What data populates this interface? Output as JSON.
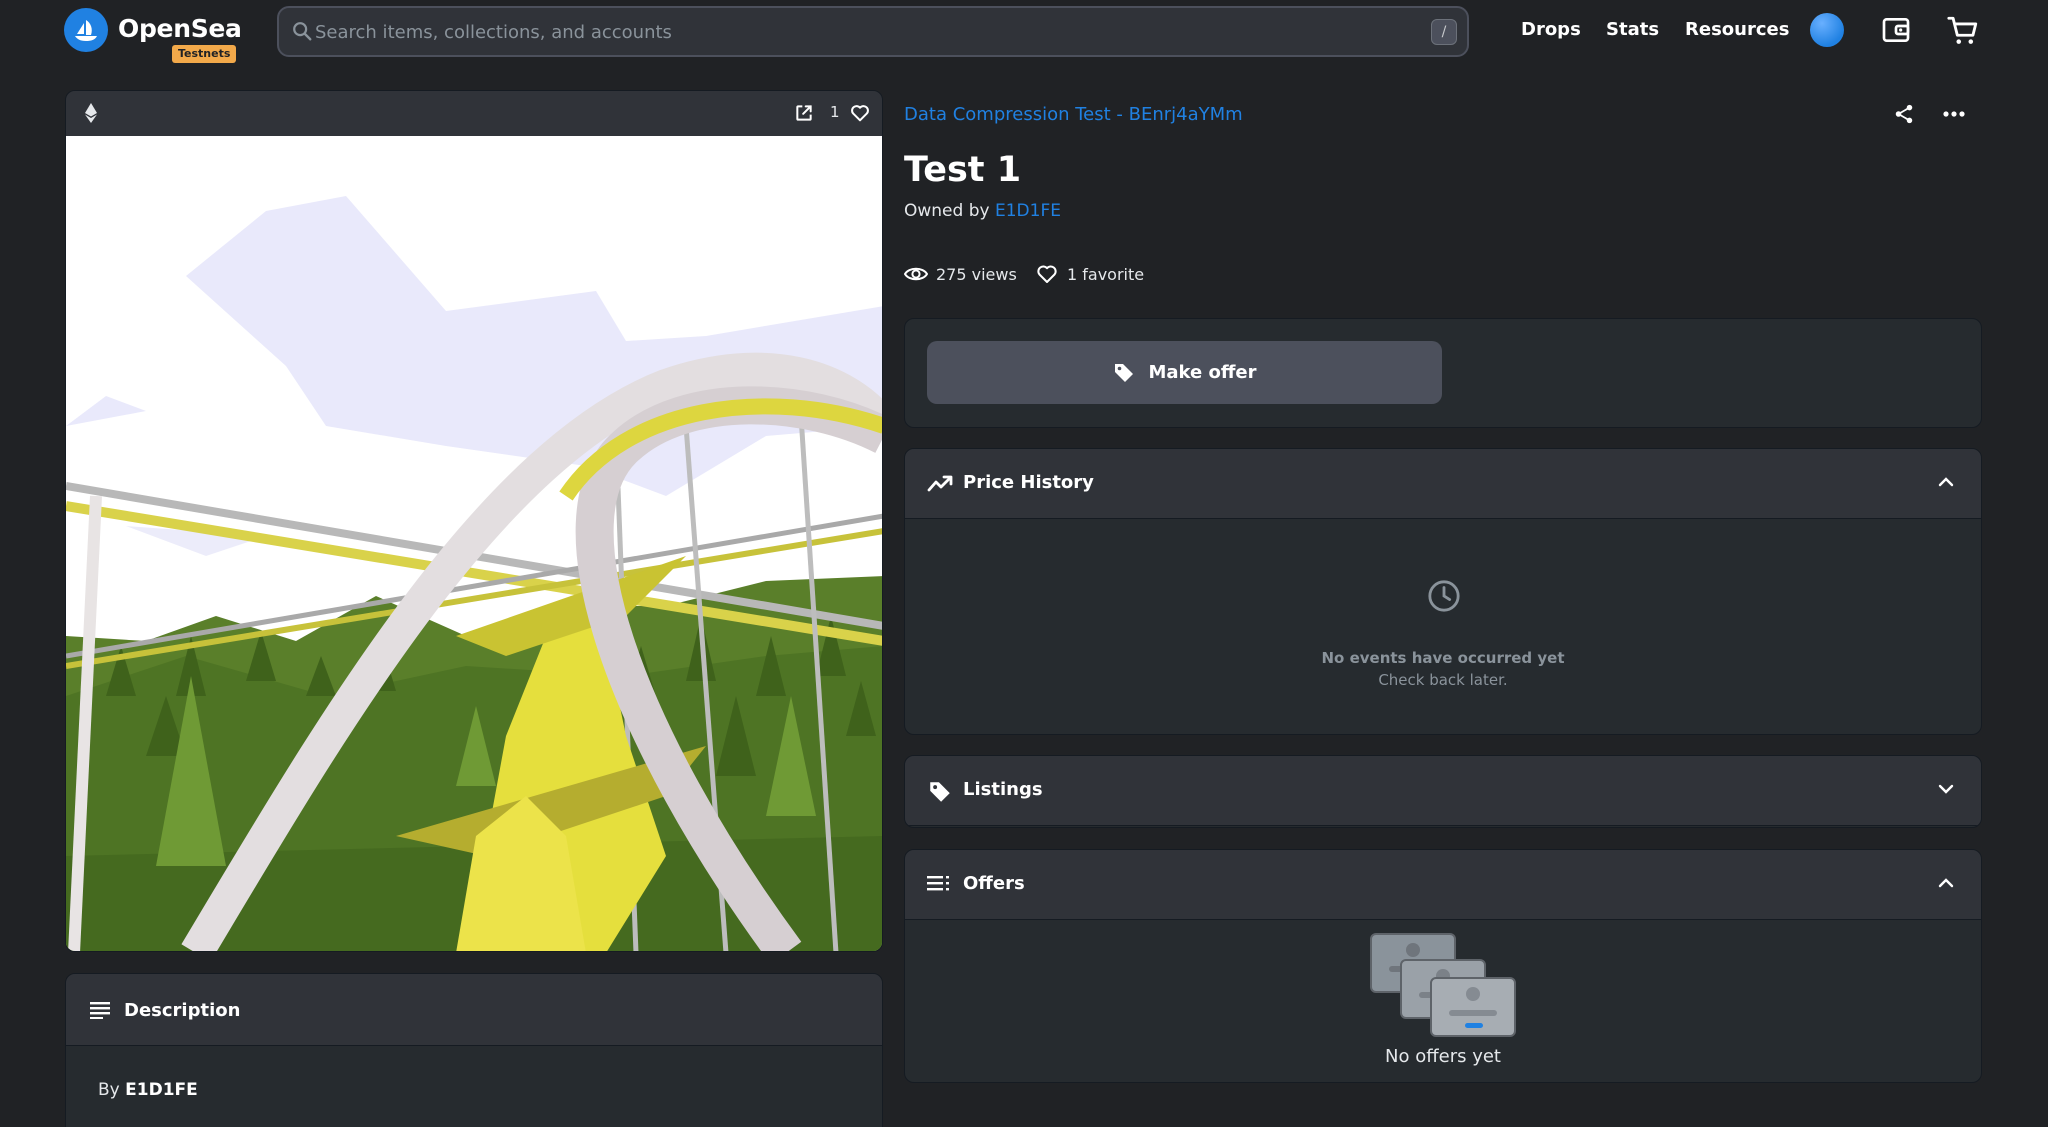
{
  "header": {
    "brand": "OpenSea",
    "network_badge": "Testnets",
    "search_placeholder": "Search items, collections, and accounts",
    "search_shortcut": "/",
    "nav": [
      "Drops",
      "Stats",
      "Resources"
    ]
  },
  "media": {
    "favorites_count": "1"
  },
  "description": {
    "title": "Description",
    "by_prefix": "By",
    "creator": "E1D1FE"
  },
  "item": {
    "collection": "Data Compression Test - BEnrj4aYMm",
    "title": "Test 1",
    "owned_by_prefix": "Owned by",
    "owner": "E1D1FE",
    "views": "275 views",
    "favorites": "1 favorite"
  },
  "actions": {
    "make_offer": "Make offer"
  },
  "panels": {
    "price_history": {
      "title": "Price History",
      "empty_title": "No events have occurred yet",
      "empty_sub": "Check back later."
    },
    "listings": {
      "title": "Listings"
    },
    "offers": {
      "title": "Offers",
      "empty": "No offers yet"
    }
  },
  "colors": {
    "accent": "#2081e2",
    "background": "#202225",
    "panel": "#262b2f",
    "testnets_badge": "#f2a94a"
  }
}
